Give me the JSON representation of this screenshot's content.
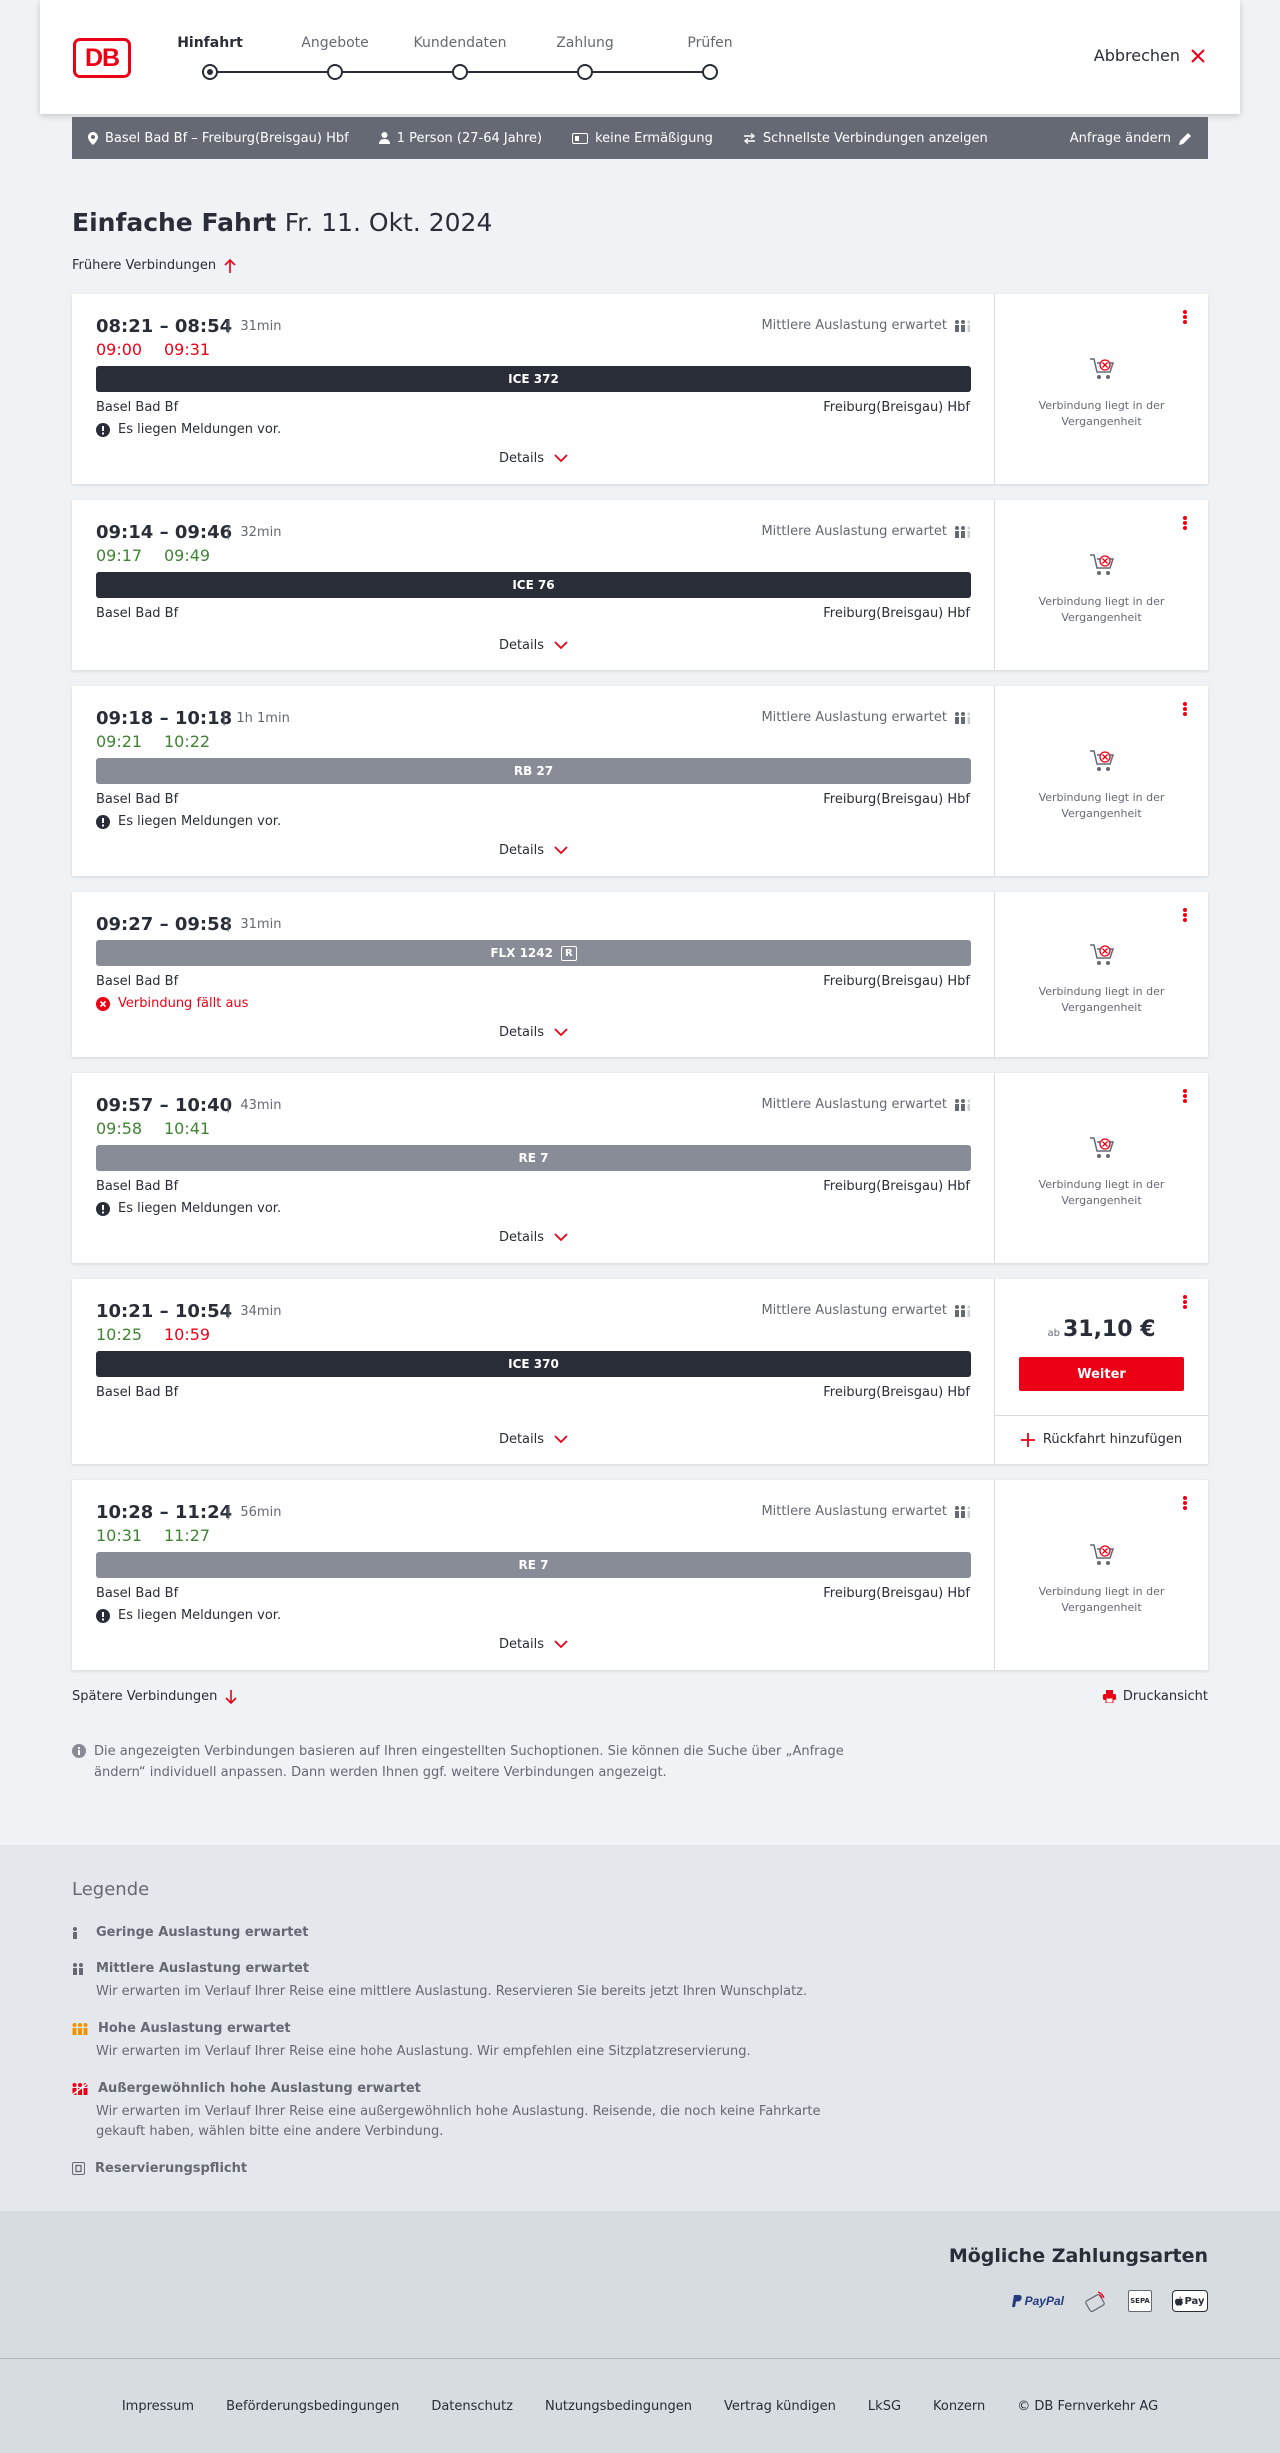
{
  "header": {
    "logo": "DB",
    "steps": [
      "Hinfahrt",
      "Angebote",
      "Kundendaten",
      "Zahlung",
      "Prüfen"
    ],
    "cancel": "Abbrechen"
  },
  "search_bar": {
    "route": "Basel Bad Bf – Freiburg(Breisgau) Hbf",
    "passengers": "1 Person (27-64 Jahre)",
    "discount": "keine Ermäßigung",
    "option": "Schnellste Verbindungen anzeigen",
    "edit": "Anfrage ändern"
  },
  "title": {
    "main": "Einfache Fahrt",
    "date": "Fr. 11. Okt. 2024"
  },
  "earlier": "Frühere Verbindungen",
  "later": "Spätere Verbindungen",
  "print": "Druckansicht",
  "info": "Die angezeigten Verbindungen basieren auf Ihren eingestellten Suchoptionen. Sie können die Suche über „Anfrage ändern“ individuell anpassen. Dann werden Ihnen ggf. weitere Verbindungen angezeigt.",
  "connections": [
    {
      "times": "08:21 – 08:54",
      "dur": "31min",
      "rt1": "09:00",
      "rt2": "09:31",
      "train": "ICE 372",
      "from": "Basel Bad Bf",
      "to": "Freiburg(Breisgau) Hbf",
      "load": "Mittlere Auslastung erwartet",
      "msg": "Es liegen Meldungen vor.",
      "details": "Details",
      "past": "Verbindung liegt in der Vergangenheit"
    },
    {
      "times": "09:14 – 09:46",
      "dur": "32min",
      "rt1": "09:17",
      "rt2": "09:49",
      "train": "ICE 76",
      "from": "Basel Bad Bf",
      "to": "Freiburg(Breisgau) Hbf",
      "load": "Mittlere Auslastung erwartet",
      "details": "Details",
      "past": "Verbindung liegt in der Vergangenheit"
    },
    {
      "times": "09:18 – 10:18",
      "dur": "1h 1min",
      "rt1": "09:21",
      "rt2": "10:22",
      "train": "RB 27",
      "from": "Basel Bad Bf",
      "to": "Freiburg(Breisgau) Hbf",
      "load": "Mittlere Auslastung erwartet",
      "msg": "Es liegen Meldungen vor.",
      "details": "Details",
      "past": "Verbindung liegt in der Vergangenheit"
    },
    {
      "times": "09:27 – 09:58",
      "dur": "31min",
      "train": "FLX 1242",
      "train_badge": "R",
      "from": "Basel Bad Bf",
      "to": "Freiburg(Breisgau) Hbf",
      "msg": "Verbindung fällt aus",
      "details": "Details",
      "past": "Verbindung liegt in der Vergangenheit"
    },
    {
      "times": "09:57 – 10:40",
      "dur": "43min",
      "rt1": "09:58",
      "rt2": "10:41",
      "train": "RE 7",
      "from": "Basel Bad Bf",
      "to": "Freiburg(Breisgau) Hbf",
      "load": "Mittlere Auslastung erwartet",
      "msg": "Es liegen Meldungen vor.",
      "details": "Details",
      "past": "Verbindung liegt in der Vergangenheit"
    },
    {
      "times": "10:21 – 10:54",
      "dur": "34min",
      "rt1": "10:25",
      "rt2": "10:59",
      "train": "ICE 370",
      "from": "Basel Bad Bf",
      "to": "Freiburg(Breisgau) Hbf",
      "load": "Mittlere Auslastung erwartet",
      "details": "Details",
      "price_prefix": "ab",
      "price": "31,10 €",
      "button": "Weiter",
      "return": "Rückfahrt hinzufügen"
    },
    {
      "times": "10:28 – 11:24",
      "dur": "56min",
      "rt1": "10:31",
      "rt2": "11:27",
      "train": "RE 7",
      "from": "Basel Bad Bf",
      "to": "Freiburg(Breisgau) Hbf",
      "load": "Mittlere Auslastung erwartet",
      "msg": "Es liegen Meldungen vor.",
      "details": "Details",
      "past": "Verbindung liegt in der Vergangenheit"
    }
  ],
  "legend": {
    "title": "Legende",
    "items": [
      {
        "t": "Geringe Auslastung erwartet"
      },
      {
        "t": "Mittlere Auslastung erwartet",
        "d": "Wir erwarten im Verlauf Ihrer Reise eine mittlere Auslastung. Reservieren Sie bereits jetzt Ihren Wunschplatz."
      },
      {
        "t": "Hohe Auslastung erwartet",
        "d": "Wir erwarten im Verlauf Ihrer Reise eine hohe Auslastung. Wir empfehlen eine Sitzplatzreservierung."
      },
      {
        "t": "Außergewöhnlich hohe Auslastung erwartet",
        "d": "Wir erwarten im Verlauf Ihrer Reise eine außergewöhnlich hohe Auslastung. Reisende, die noch keine Fahrkarte gekauft haben, wählen bitte eine andere Verbindung."
      },
      {
        "t": "Reservierungspflicht"
      }
    ]
  },
  "payment": {
    "title": "Mögliche Zahlungsarten",
    "paypal": "PayPal",
    "sepa": "SEPA",
    "applepay": "Pay"
  },
  "footer": [
    "Impressum",
    "Beförderungsbedingungen",
    "Datenschutz",
    "Nutzungsbedingungen",
    "Vertrag kündigen",
    "LkSG",
    "Konzern",
    "© DB Fernverkehr AG"
  ],
  "colors": {
    "red": "#ec0016",
    "green": "#408335",
    "dark": "#282d37",
    "grey": "#878c96"
  }
}
